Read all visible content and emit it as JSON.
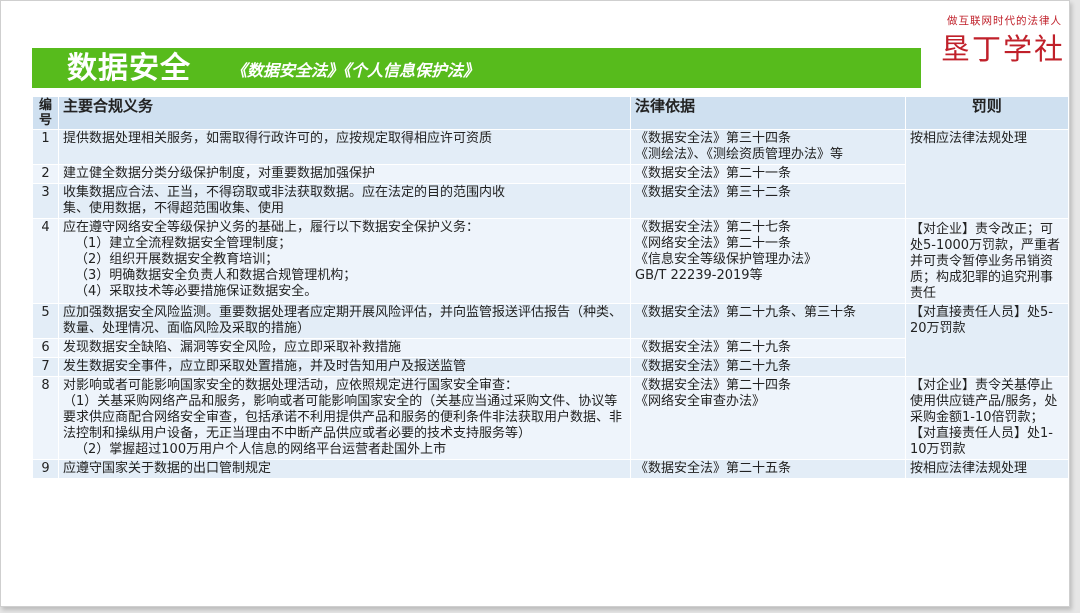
{
  "header": {
    "title": "数据安全",
    "subtitle": "《数据安全法》《个人信息保护法》"
  },
  "logo": {
    "tagline": "做互联网时代的法律人",
    "name": "垦丁学社"
  },
  "table": {
    "headers": {
      "num": "编号",
      "duty": "主要合规义务",
      "basis": "法律依据",
      "penalty": "罚则"
    },
    "rows": [
      {
        "num": "1",
        "duty": "提供数据处理相关服务，如需取得行政许可的，应按规定取得相应许可资质",
        "basis": [
          "《数据安全法》第三十四条",
          "《测绘法》、《测绘资质管理办法》等"
        ]
      },
      {
        "num": "2",
        "duty": "建立健全数据分类分级保护制度，对重要数据加强保护",
        "basis": [
          "《数据安全法》第二十一条"
        ]
      },
      {
        "num": "3",
        "duty": "收集数据应合法、正当，不得窃取或非法获取数据。应在法定的目的范围内收集、使用数据，不得超范围收集、使用",
        "basis": [
          "《数据安全法》第三十二条"
        ]
      },
      {
        "num": "4",
        "duty": "应在遵守网络安全等级保护义务的基础上，履行以下数据安全保护义务：",
        "sub": [
          "（1）建立全流程数据安全管理制度；",
          "（2）组织开展数据安全教育培训；",
          "（3）明确数据安全负责人和数据合规管理机构；",
          "（4）采取技术等必要措施保证数据安全。"
        ],
        "basis": [
          "《数据安全法》第二十七条",
          "《网络安全法》第二十一条",
          "《信息安全等级保护管理办法》",
          "GB/T 22239-2019等"
        ]
      },
      {
        "num": "5",
        "duty": "应加强数据安全风险监测。重要数据处理者应定期开展风险评估，并向监管报送评估报告（种类、数量、处理情况、面临风险及采取的措施）",
        "basis": [
          "《数据安全法》第二十九条、第三十条"
        ]
      },
      {
        "num": "6",
        "duty": "发现数据安全缺陷、漏洞等安全风险，应立即采取补救措施",
        "basis": [
          "《数据安全法》第二十九条"
        ]
      },
      {
        "num": "7",
        "duty": "发生数据安全事件，应立即采取处置措施，并及时告知用户及报送监管",
        "basis": [
          "《数据安全法》第二十九条"
        ]
      },
      {
        "num": "8",
        "duty": "对影响或者可能影响国家安全的数据处理活动，应依照规定进行国家安全审查：",
        "sub": [
          "（1）关基采购网络产品和服务，影响或者可能影响国家安全的（关基应当通过采购文件、协议等要求供应商配合网络安全审查，包括承诺不利用提供产品和服务的便利条件非法获取用户数据、非法控制和操纵用户设备，无正当理由不中断产品供应或者必要的技术支持服务等）",
          "（2）掌握超过100万用户个人信息的网络平台运营者赴国外上市"
        ],
        "basis": [
          "《数据安全法》第二十四条",
          "《网络安全审查办法》"
        ]
      },
      {
        "num": "9",
        "duty": "应遵守国家关于数据的出口管制规定",
        "basis": [
          "《数据安全法》第二十五条"
        ]
      }
    ],
    "penalties": {
      "p1": "按相应法律法规处理",
      "p2": "【对企业】责令改正；可处5-1000万罚款，严重者并可责令暂停业务吊销资质；构成犯罪的追究刑事责任",
      "p3": "【对直接责任人员】处5-20万罚款",
      "p4a": "【对企业】责令关基停止使用供应链产品/服务，处采购金额1-10倍罚款；",
      "p4b": "【对直接责任人员】处1-10万罚款",
      "p5": "按相应法律法规处理"
    }
  }
}
